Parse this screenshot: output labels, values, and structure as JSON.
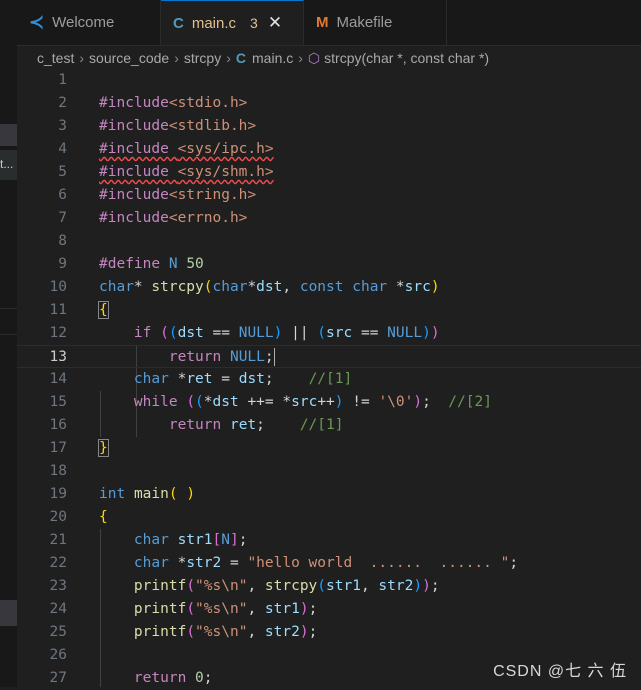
{
  "tabs": [
    {
      "icon": "vscode-icon",
      "icon_glyph": "≺",
      "label": "Welcome"
    },
    {
      "icon": "c-file-icon",
      "icon_glyph": "C",
      "label": "main.c",
      "problems": "3",
      "close": "✕"
    },
    {
      "icon": "makefile-icon",
      "icon_glyph": "M",
      "label": "Makefile"
    }
  ],
  "breadcrumb": {
    "items": [
      "c_test",
      "source_code",
      "strcpy"
    ],
    "file_icon": "C",
    "file": "main.c",
    "symbol_icon": "⬡",
    "symbol": "strcpy(char *, const char *)",
    "separator": "›"
  },
  "sidebar_fragment": "t...",
  "editor": {
    "current_line": 13,
    "line_numbers": [
      "1",
      "2",
      "3",
      "4",
      "5",
      "6",
      "7",
      "8",
      "9",
      "10",
      "11",
      "12",
      "13",
      "14",
      "15",
      "16",
      "17",
      "18",
      "19",
      "20",
      "21",
      "22",
      "23",
      "24",
      "25",
      "26",
      "27"
    ]
  },
  "watermark": "CSDN @七 六 伍",
  "colors": {
    "background": "#1f1f1f",
    "keyword": "#569cd6",
    "preprocessor": "#c586c0",
    "string": "#ce9178",
    "comment": "#6a9955",
    "function": "#dcdcaa",
    "variable": "#9cdcfe",
    "number": "#b5cea8",
    "error_squiggle": "#f14c4c"
  }
}
